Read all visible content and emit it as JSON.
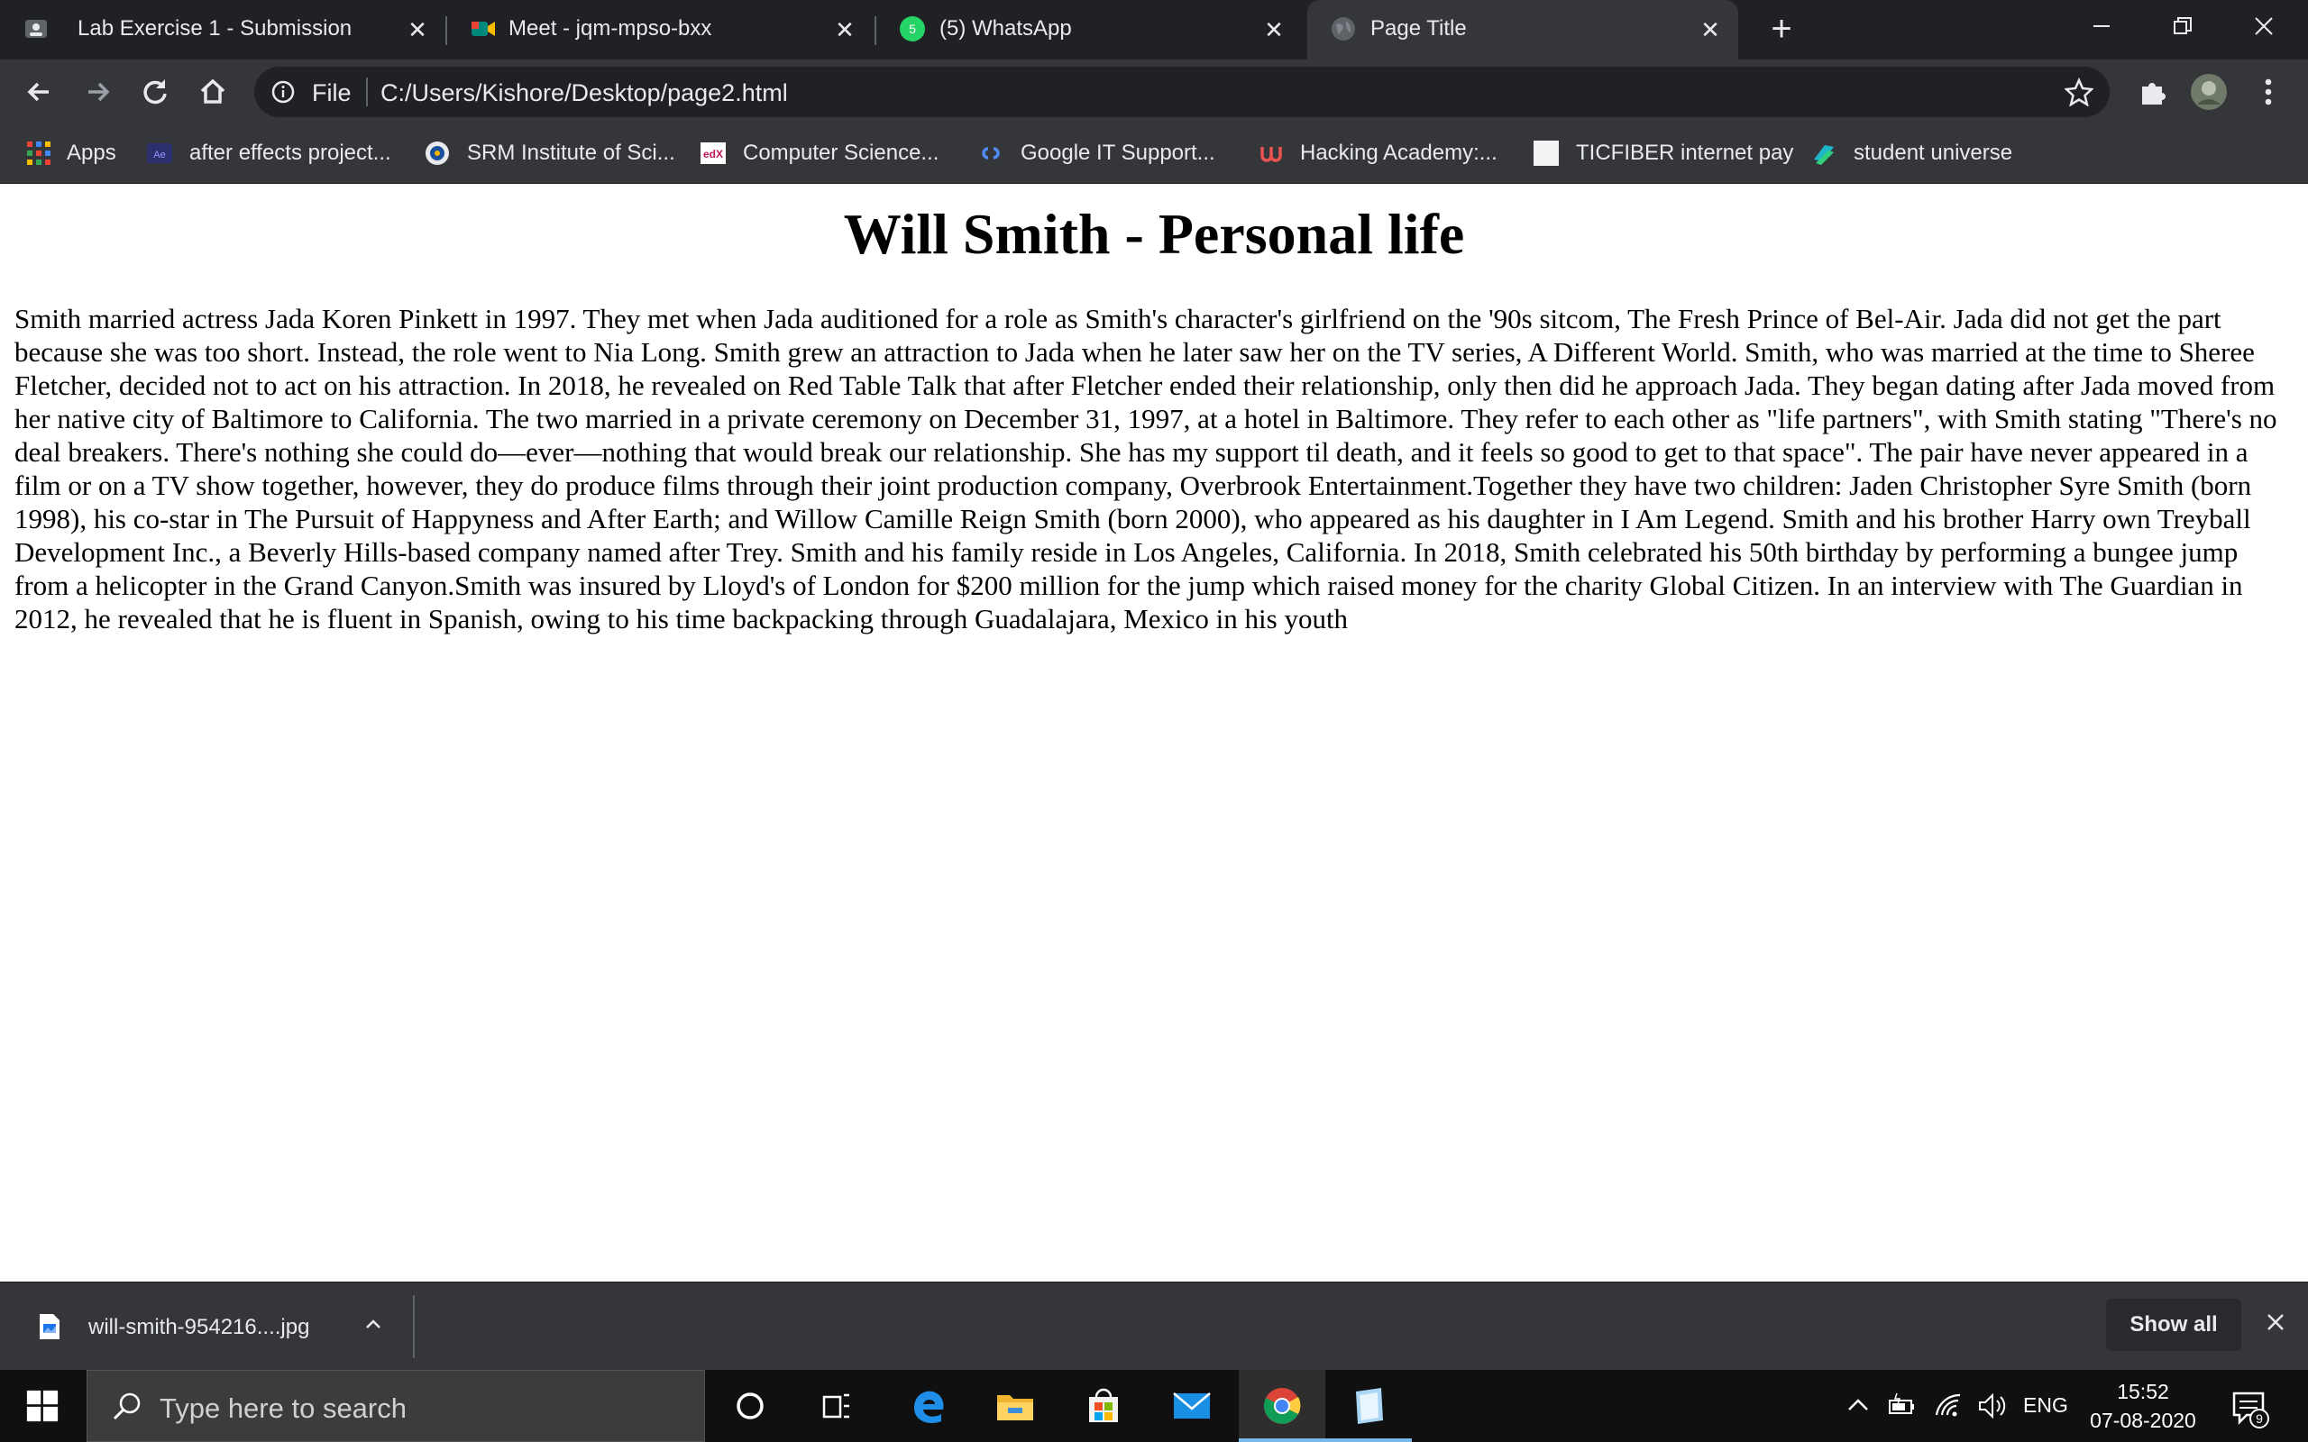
{
  "browser": {
    "tabs": [
      {
        "title": "Lab Exercise 1 - Submission",
        "icon": "classroom-icon"
      },
      {
        "title": "Meet - jqm-mpso-bxx",
        "icon": "meet-icon"
      },
      {
        "title": "(5) WhatsApp",
        "icon": "whatsapp-icon",
        "badge": "5"
      },
      {
        "title": "Page Title",
        "icon": "globe-icon",
        "active": true
      }
    ],
    "address_bar": {
      "scheme_label": "File",
      "url": "C:/Users/Kishore/Desktop/page2.html"
    },
    "bookmarks": [
      {
        "label": "Apps",
        "icon": "apps-grid-icon"
      },
      {
        "label": "after effects project...",
        "icon": "after-effects-icon"
      },
      {
        "label": "SRM Institute of Sci...",
        "icon": "srm-icon"
      },
      {
        "label": "Computer Science...",
        "icon": "edx-icon"
      },
      {
        "label": "Google IT Support...",
        "icon": "coursera-icon"
      },
      {
        "label": "Hacking Academy:...",
        "icon": "udemy-icon"
      },
      {
        "label": "TICFIBER internet pay",
        "icon": "blank-page-icon"
      },
      {
        "label": "student universe",
        "icon": "student-universe-icon"
      }
    ]
  },
  "page": {
    "heading": "Will Smith - Personal life",
    "paragraph": "Smith married actress Jada Koren Pinkett in 1997. They met when Jada auditioned for a role as Smith's character's girlfriend on the '90s sitcom, The Fresh Prince of Bel-Air. Jada did not get the part because she was too short. Instead, the role went to Nia Long. Smith grew an attraction to Jada when he later saw her on the TV series, A Different World. Smith, who was married at the time to Sheree Fletcher, decided not to act on his attraction. In 2018, he revealed on Red Table Talk that after Fletcher ended their relationship, only then did he approach Jada. They began dating after Jada moved from her native city of Baltimore to California. The two married in a private ceremony on December 31, 1997, at a hotel in Baltimore. They refer to each other as \"life partners\", with Smith stating \"There's no deal breakers. There's nothing she could do—ever—nothing that would break our relationship. She has my support til death, and it feels so good to get to that space\". The pair have never appeared in a film or on a TV show together, however, they do produce films through their joint production company, Overbrook Entertainment.Together they have two children: Jaden Christopher Syre Smith (born 1998), his co-star in The Pursuit of Happyness and After Earth; and Willow Camille Reign Smith (born 2000), who appeared as his daughter in I Am Legend. Smith and his brother Harry own Treyball Development Inc., a Beverly Hills-based company named after Trey. Smith and his family reside in Los Angeles, California. In 2018, Smith celebrated his 50th birthday by performing a bungee jump from a helicopter in the Grand Canyon.Smith was insured by Lloyd's of London for $200 million for the jump which raised money for the charity Global Citizen. In an interview with The Guardian in 2012, he revealed that he is fluent in Spanish, owing to his time backpacking through Guadalajara, Mexico in his youth"
  },
  "downloads": {
    "file_name": "will-smith-954216....jpg",
    "show_all_label": "Show all"
  },
  "taskbar": {
    "search_placeholder": "Type here to search",
    "language": "ENG",
    "time": "15:52",
    "date": "07-08-2020",
    "notification_count": "9",
    "pinned_apps": [
      "cortana-icon",
      "task-view-icon",
      "edge-icon",
      "file-explorer-icon",
      "microsoft-store-icon",
      "mail-icon",
      "chrome-icon",
      "notepad-icon"
    ]
  },
  "colors": {
    "tab_strip": "#202124",
    "toolbar": "#35363a",
    "taskbar": "#101010",
    "page_background": "#ffffff"
  }
}
